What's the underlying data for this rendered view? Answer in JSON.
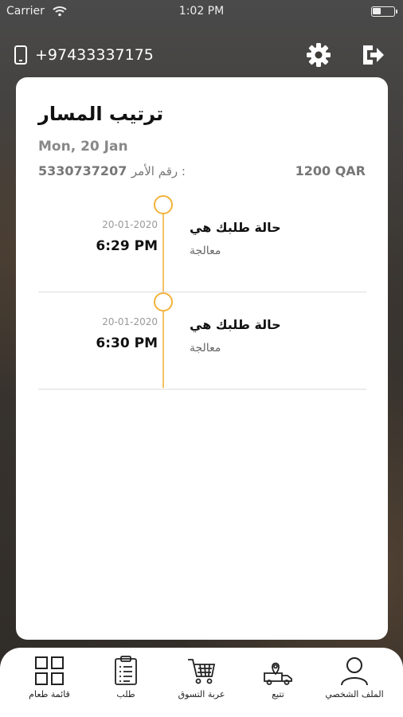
{
  "status_bar": {
    "carrier": "Carrier",
    "time": "1:02 PM"
  },
  "header": {
    "phone": "+97433337175"
  },
  "order": {
    "title": "ترتيب المسار",
    "date": "Mon, 20 Jan",
    "number_label": "رقم الأمر :",
    "number": "5330737207",
    "amount": "1200 QAR"
  },
  "timeline": [
    {
      "date": "20-01-2020",
      "time": "6:29 PM",
      "status": "حالة طلبك هي",
      "substatus": "معالجة"
    },
    {
      "date": "20-01-2020",
      "time": "6:30 PM",
      "status": "حالة طلبك هي",
      "substatus": "معالجة"
    }
  ],
  "tabs": [
    {
      "label": "قائمة طعام",
      "icon": "grid-icon"
    },
    {
      "label": "طلب",
      "icon": "clipboard-icon"
    },
    {
      "label": "عربة التسوق",
      "icon": "cart-icon"
    },
    {
      "label": "تتبع",
      "icon": "delivery-truck-icon"
    },
    {
      "label": "الملف الشخصي",
      "icon": "person-icon"
    }
  ],
  "colors": {
    "accent": "#f3b23b",
    "timeline_line": "#f3c266"
  }
}
